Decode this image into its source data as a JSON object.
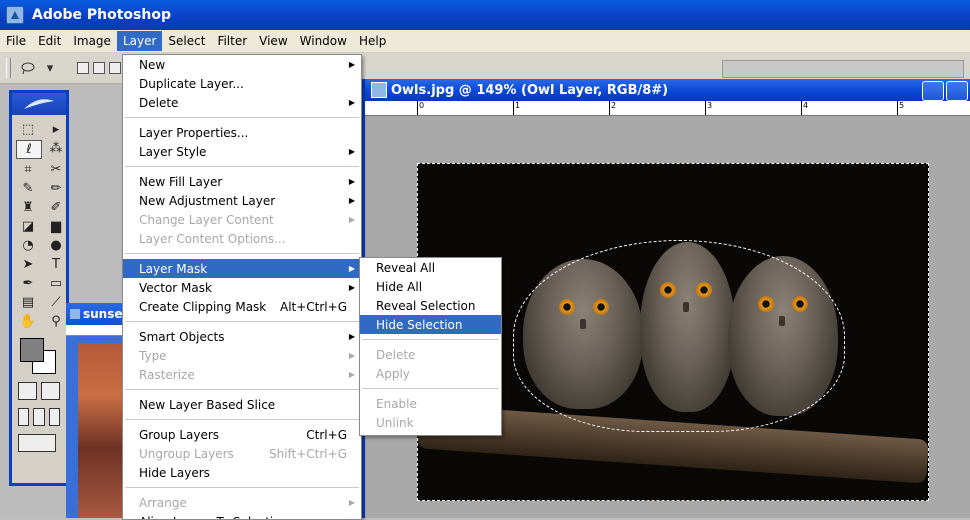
{
  "app": {
    "title": "Adobe Photoshop"
  },
  "menubar": [
    "File",
    "Edit",
    "Image",
    "Layer",
    "Select",
    "Filter",
    "View",
    "Window",
    "Help"
  ],
  "menubar_active": "Layer",
  "document": {
    "title": "Owls.jpg @ 149% (Owl Layer, RGB/8#)",
    "ruler_ticks": [
      "0",
      "1",
      "2",
      "3",
      "4",
      "5"
    ]
  },
  "background_doc": {
    "title": "sunse"
  },
  "layer_menu": {
    "items": [
      {
        "label": "New",
        "submenu": true
      },
      {
        "label": "Duplicate Layer..."
      },
      {
        "label": "Delete",
        "submenu": true
      },
      {
        "sep": true
      },
      {
        "label": "Layer Properties..."
      },
      {
        "label": "Layer Style",
        "submenu": true
      },
      {
        "sep": true
      },
      {
        "label": "New Fill Layer",
        "submenu": true
      },
      {
        "label": "New Adjustment Layer",
        "submenu": true
      },
      {
        "label": "Change Layer Content",
        "submenu": true,
        "disabled": true
      },
      {
        "label": "Layer Content Options...",
        "disabled": true
      },
      {
        "sep": true
      },
      {
        "label": "Layer Mask",
        "submenu": true,
        "highlighted": true
      },
      {
        "label": "Vector Mask",
        "submenu": true
      },
      {
        "label": "Create Clipping Mask",
        "shortcut": "Alt+Ctrl+G"
      },
      {
        "sep": true
      },
      {
        "label": "Smart Objects",
        "submenu": true
      },
      {
        "label": "Type",
        "submenu": true,
        "disabled": true
      },
      {
        "label": "Rasterize",
        "submenu": true,
        "disabled": true
      },
      {
        "sep": true
      },
      {
        "label": "New Layer Based Slice"
      },
      {
        "sep": true
      },
      {
        "label": "Group Layers",
        "shortcut": "Ctrl+G"
      },
      {
        "label": "Ungroup Layers",
        "shortcut": "Shift+Ctrl+G",
        "disabled": true
      },
      {
        "label": "Hide Layers"
      },
      {
        "sep": true
      },
      {
        "label": "Arrange",
        "submenu": true,
        "disabled": true
      },
      {
        "label": "Align Layers To Selection",
        "submenu": true
      }
    ]
  },
  "layer_mask_submenu": {
    "items": [
      {
        "label": "Reveal All"
      },
      {
        "label": "Hide All"
      },
      {
        "label": "Reveal Selection"
      },
      {
        "label": "Hide Selection",
        "highlighted": true
      },
      {
        "sep": true
      },
      {
        "label": "Delete",
        "disabled": true
      },
      {
        "label": "Apply",
        "disabled": true
      },
      {
        "sep": true
      },
      {
        "label": "Enable",
        "disabled": true
      },
      {
        "label": "Unlink",
        "disabled": true
      }
    ]
  },
  "colors": {
    "accent": "#316ac5",
    "title_blue": "#0a3fc4",
    "menu_bg": "#ffffff",
    "disabled": "#a8a8a8"
  }
}
